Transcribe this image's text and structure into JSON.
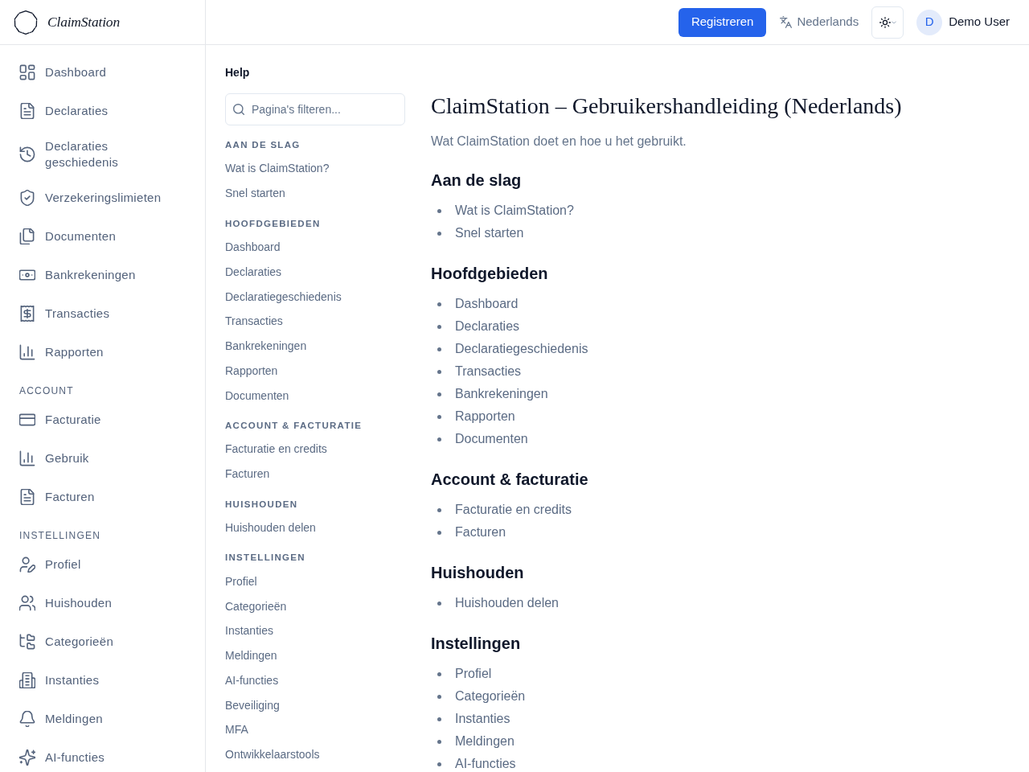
{
  "brand": {
    "name": "ClaimStation"
  },
  "top_bar": {
    "register_button": "Registreren",
    "language": "Nederlands",
    "user": {
      "initial": "D",
      "name": "Demo User"
    }
  },
  "sidebar": {
    "sections": [
      {
        "items": [
          "Dashboard",
          "Declaraties",
          "Declaraties geschiedenis",
          "Verzekeringslimieten",
          "Documenten",
          "Bankrekeningen",
          "Transacties",
          "Rapporten"
        ]
      },
      {
        "heading": "ACCOUNT",
        "items": [
          "Facturatie",
          "Gebruik",
          "Facturen"
        ]
      },
      {
        "heading": "INSTELLINGEN",
        "items": [
          "Profiel",
          "Huishouden",
          "Categorieën",
          "Instanties",
          "Meldingen",
          "AI-functies"
        ]
      }
    ]
  },
  "help_nav": {
    "title": "Help",
    "search": {
      "placeholder": "Pagina's filteren..."
    },
    "sections": [
      {
        "heading": "AAN DE SLAG",
        "links": [
          "Wat is ClaimStation?",
          "Snel starten"
        ]
      },
      {
        "heading": "HOOFDGEBIEDEN",
        "links": [
          "Dashboard",
          "Declaraties",
          "Declaratiegeschiedenis",
          "Transacties",
          "Bankrekeningen",
          "Rapporten",
          "Documenten"
        ]
      },
      {
        "heading": "ACCOUNT & FACTURATIE",
        "links": [
          "Facturatie en credits",
          "Facturen"
        ]
      },
      {
        "heading": "HUISHOUDEN",
        "links": [
          "Huishouden delen"
        ]
      },
      {
        "heading": "INSTELLINGEN",
        "links": [
          "Profiel",
          "Categorieën",
          "Instanties",
          "Meldingen",
          "AI-functies",
          "Beveiliging",
          "MFA",
          "Ontwikkelaarstools"
        ]
      }
    ]
  },
  "article": {
    "title": "ClaimStation – Gebruikershandleiding (Nederlands)",
    "subtitle": "Wat ClaimStation doet en hoe u het gebruikt.",
    "sections": [
      {
        "heading": "Aan de slag",
        "items": [
          "Wat is ClaimStation?",
          "Snel starten"
        ]
      },
      {
        "heading": "Hoofdgebieden",
        "items": [
          "Dashboard",
          "Declaraties",
          "Declaratiegeschiedenis",
          "Transacties",
          "Bankrekeningen",
          "Rapporten",
          "Documenten"
        ]
      },
      {
        "heading": "Account & facturatie",
        "items": [
          "Facturatie en credits",
          "Facturen"
        ]
      },
      {
        "heading": "Huishouden",
        "items": [
          "Huishouden delen"
        ]
      },
      {
        "heading": "Instellingen",
        "items": [
          "Profiel",
          "Categorieën",
          "Instanties",
          "Meldingen",
          "AI-functies"
        ]
      }
    ]
  }
}
